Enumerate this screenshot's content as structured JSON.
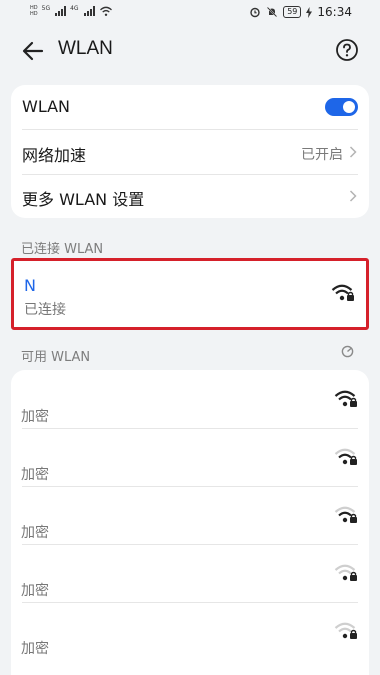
{
  "status_bar": {
    "mini_line1": "HD",
    "mini_line2": "HD",
    "net_label1": "5G",
    "net_label2": "4G",
    "battery": "59",
    "time": "16:34"
  },
  "header": {
    "title": "WLAN"
  },
  "settings": {
    "wlan_label": "WLAN",
    "wlan_enabled": true,
    "accel_label": "网络加速",
    "accel_value": "已开启",
    "more_label": "更多 WLAN 设置"
  },
  "connected": {
    "section_title": "已连接 WLAN",
    "name": "N",
    "status": "已连接"
  },
  "available": {
    "section_title": "可用 WLAN",
    "networks": [
      {
        "name": "",
        "security": "加密"
      },
      {
        "name": "",
        "security": "加密"
      },
      {
        "name": "",
        "security": "加密"
      },
      {
        "name": "",
        "security": "加密"
      },
      {
        "name": "",
        "security": "加密"
      }
    ]
  },
  "colors": {
    "accent": "#1e66e8",
    "highlight_border": "#d5202a"
  }
}
